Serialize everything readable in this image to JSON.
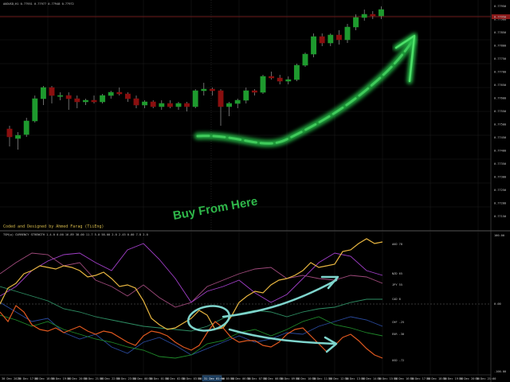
{
  "top_info": "AUDUSD,H1 0.77951 0.77977 0.77948 0.77972",
  "sub_info": "TSM(p) CURRENCY STRENGTH 1.4.0 0.00 16.89 38.00 11.7 5.0 58.00 2.0 2.45 0.00 7.8 2.0",
  "credit_text": "Coded and Designed by Ahmed Farag (TiiEng)",
  "cta_text": "Buy From Here",
  "top_right_label": "0.77950",
  "sub_top_right_label": "100.00",
  "price_labels": [
    "0.77950",
    "0.77900",
    "0.77850",
    "0.77800",
    "0.77750",
    "0.77700",
    "0.77650",
    "0.77600",
    "0.77550",
    "0.77500",
    "0.77450",
    "0.77400",
    "0.77350",
    "0.77300",
    "0.77250",
    "0.77200",
    "0.77150"
  ],
  "sub_labels": [
    "100.00",
    "0.00",
    "-100.00"
  ],
  "time_labels": [
    "30 Dec 2020",
    "30 Dec 17:00",
    "30 Dec 18:00",
    "30 Dec 19:00",
    "30 Dec 20:00",
    "30 Dec 21:00",
    "30 Dec 22:00",
    "30 Dec 23:00",
    "31 Dec 00:00",
    "31 Dec 01:00",
    "31 Dec 02:00",
    "31 Dec 03:00",
    "31 Dec 04:00",
    "31 Dec 05:00",
    "31 Dec 06:00",
    "31 Dec 07:00",
    "31 Dec 08:00",
    "31 Dec 09:00",
    "31 Dec 10:00",
    "31 Dec 11:00",
    "31 Dec 12:00",
    "31 Dec 13:00",
    "31 Dec 14:00",
    "31 Dec 15:00",
    "31 Dec 16:00",
    "31 Dec 17:00",
    "31 Dec 18:00",
    "31 Dec 19:00",
    "31 Dec 20:00",
    "31 Dec 21:00"
  ],
  "time_badge": "31 Dec 01:00",
  "currency_labels": [
    {
      "code": "AUD",
      "value": "78",
      "color": "#e8b640"
    },
    {
      "code": "NZD",
      "value": "65",
      "color": "#a23fc9"
    },
    {
      "code": "JPY",
      "value": "55",
      "color": "#a04a7c"
    },
    {
      "code": "CAD",
      "value": "8",
      "color": "#2e8f64"
    },
    {
      "code": "CHF",
      "value": "-25",
      "color": "#2a4a9e"
    },
    {
      "code": "EUR",
      "value": "-30",
      "color": "#1f8a2a"
    },
    {
      "code": "USD",
      "value": "-72",
      "color": "#e0581f"
    }
  ],
  "colors": {
    "bull_candle": "#1e9a2e",
    "bear_candle": "#8a0f0f",
    "wick": "#aaaaaa",
    "grid": "#262626",
    "bid_line": "#8a1a1a",
    "arrow_green": "#27c049",
    "arrow_cyan": "#7ed4cc",
    "text": "#c8c8c8"
  },
  "candles": [
    {
      "o": 108,
      "h": 112,
      "l": 86,
      "c": 98
    },
    {
      "o": 96,
      "h": 104,
      "l": 82,
      "c": 100
    },
    {
      "o": 101,
      "h": 122,
      "l": 98,
      "c": 118
    },
    {
      "o": 118,
      "h": 150,
      "l": 116,
      "c": 146
    },
    {
      "o": 146,
      "h": 162,
      "l": 138,
      "c": 160
    },
    {
      "o": 160,
      "h": 162,
      "l": 140,
      "c": 150
    },
    {
      "o": 150,
      "h": 154,
      "l": 144,
      "c": 150
    },
    {
      "o": 150,
      "h": 154,
      "l": 132,
      "c": 146
    },
    {
      "o": 146,
      "h": 150,
      "l": 134,
      "c": 142
    },
    {
      "o": 142,
      "h": 146,
      "l": 138,
      "c": 144
    },
    {
      "o": 144,
      "h": 150,
      "l": 140,
      "c": 142
    },
    {
      "o": 142,
      "h": 152,
      "l": 140,
      "c": 150
    },
    {
      "o": 150,
      "h": 156,
      "l": 146,
      "c": 154
    },
    {
      "o": 154,
      "h": 160,
      "l": 150,
      "c": 152
    },
    {
      "o": 152,
      "h": 154,
      "l": 142,
      "c": 146
    },
    {
      "o": 146,
      "h": 150,
      "l": 134,
      "c": 138
    },
    {
      "o": 138,
      "h": 144,
      "l": 134,
      "c": 142
    },
    {
      "o": 142,
      "h": 144,
      "l": 134,
      "c": 136
    },
    {
      "o": 136,
      "h": 144,
      "l": 132,
      "c": 140
    },
    {
      "o": 140,
      "h": 144,
      "l": 134,
      "c": 136
    },
    {
      "o": 136,
      "h": 142,
      "l": 132,
      "c": 140
    },
    {
      "o": 140,
      "h": 142,
      "l": 130,
      "c": 136
    },
    {
      "o": 136,
      "h": 158,
      "l": 134,
      "c": 156
    },
    {
      "o": 156,
      "h": 166,
      "l": 150,
      "c": 158
    },
    {
      "o": 158,
      "h": 160,
      "l": 150,
      "c": 156
    },
    {
      "o": 156,
      "h": 158,
      "l": 112,
      "c": 136
    },
    {
      "o": 136,
      "h": 142,
      "l": 124,
      "c": 140
    },
    {
      "o": 140,
      "h": 146,
      "l": 134,
      "c": 144
    },
    {
      "o": 144,
      "h": 160,
      "l": 140,
      "c": 156
    },
    {
      "o": 156,
      "h": 158,
      "l": 150,
      "c": 154
    },
    {
      "o": 154,
      "h": 176,
      "l": 152,
      "c": 174
    },
    {
      "o": 174,
      "h": 180,
      "l": 170,
      "c": 172
    },
    {
      "o": 172,
      "h": 176,
      "l": 164,
      "c": 168
    },
    {
      "o": 168,
      "h": 174,
      "l": 164,
      "c": 170
    },
    {
      "o": 170,
      "h": 190,
      "l": 168,
      "c": 188
    },
    {
      "o": 188,
      "h": 204,
      "l": 186,
      "c": 202
    },
    {
      "o": 202,
      "h": 228,
      "l": 198,
      "c": 224
    },
    {
      "o": 224,
      "h": 228,
      "l": 212,
      "c": 216
    },
    {
      "o": 216,
      "h": 228,
      "l": 212,
      "c": 226
    },
    {
      "o": 226,
      "h": 232,
      "l": 214,
      "c": 220
    },
    {
      "o": 220,
      "h": 240,
      "l": 216,
      "c": 236
    },
    {
      "o": 236,
      "h": 252,
      "l": 232,
      "c": 248
    },
    {
      "o": 248,
      "h": 258,
      "l": 244,
      "c": 252
    },
    {
      "o": 252,
      "h": 256,
      "l": 246,
      "c": 250
    },
    {
      "o": 250,
      "h": 262,
      "l": 246,
      "c": 258
    }
  ]
}
